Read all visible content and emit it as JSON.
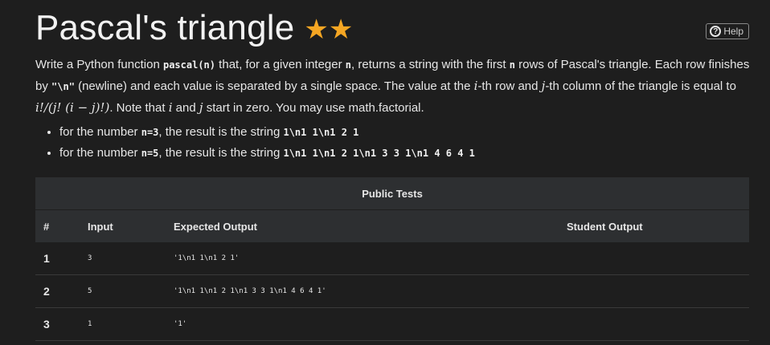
{
  "header": {
    "title": "Pascal's triangle",
    "stars": "★★",
    "help_label": "Help",
    "help_icon": "?"
  },
  "description": {
    "p1": "Write a Python function ",
    "fn": "pascal(n)",
    "p2": " that, for a given integer ",
    "n": "n",
    "p3": ", returns a string with the first ",
    "n2": "n",
    "p4": " rows of Pascal's triangle. Each row finishes by ",
    "newline_code": "\"\\n\"",
    "p5": " (newline) and each value is separated by a single space. The value at the ",
    "i": "i",
    "p6": "-th row and ",
    "j": "j",
    "p7": "-th column of the triangle is equal to ",
    "formula": "i!/(j! (i − j)!)",
    "p8": ". Note that ",
    "i2": "i",
    "p9": " and ",
    "j2": "j",
    "p10": " start in zero. You may use math.factorial."
  },
  "examples": [
    {
      "pre": "for the number ",
      "arg": "n=3",
      "mid": ", the result is the string ",
      "result": "1\\n1 1\\n1 2 1"
    },
    {
      "pre": "for the number ",
      "arg": "n=5",
      "mid": ", the result is the string ",
      "result": "1\\n1 1\\n1 2 1\\n1 3 3 1\\n1 4 6 4 1"
    }
  ],
  "table": {
    "title": "Public Tests",
    "headers": [
      "#",
      "Input",
      "Expected Output",
      "Student Output"
    ],
    "rows": [
      {
        "num": "1",
        "input": "3",
        "expected": "'1\\n1 1\\n1 2 1'",
        "student": ""
      },
      {
        "num": "2",
        "input": "5",
        "expected": "'1\\n1 1\\n1 2 1\\n1 3 3 1\\n1 4 6 4 1'",
        "student": ""
      },
      {
        "num": "3",
        "input": "1",
        "expected": "'1'",
        "student": ""
      }
    ]
  },
  "colors": {
    "background": "#1e1e1e",
    "star": "#f5a623",
    "table_header": "#2d2f31"
  }
}
